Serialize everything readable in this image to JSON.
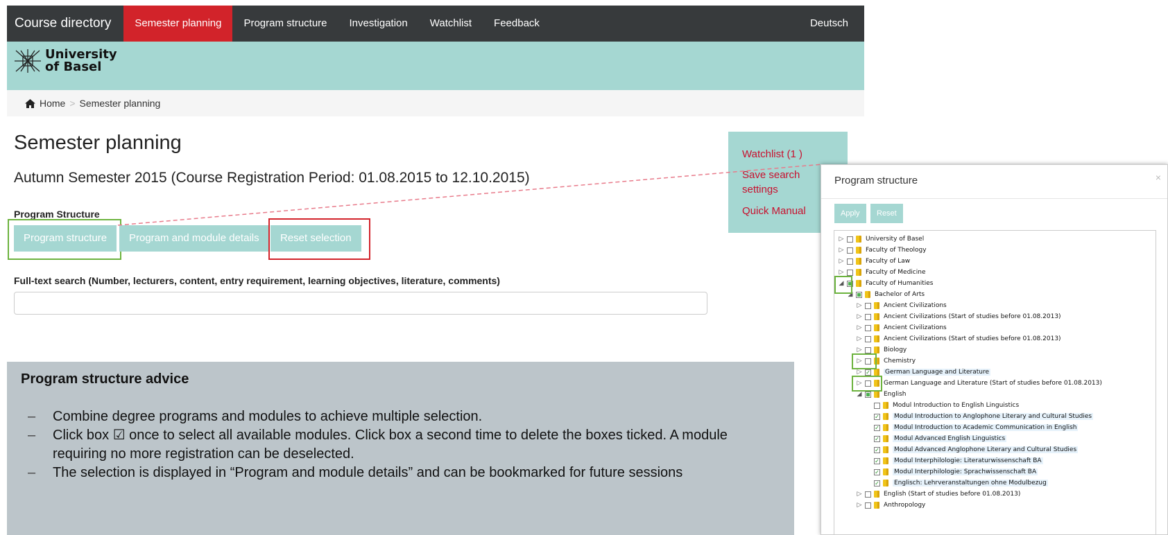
{
  "nav": {
    "brand": "Course directory",
    "items": [
      "Semester planning",
      "Program structure",
      "Investigation",
      "Watchlist",
      "Feedback"
    ],
    "active_index": 0,
    "language": "Deutsch"
  },
  "logo": {
    "line1": "University",
    "line2": "of Basel"
  },
  "breadcrumb": {
    "home": "Home",
    "current": "Semester planning"
  },
  "main": {
    "title": "Semester planning",
    "semester_info": "Autumn Semester 2015 (Course Registration Period: 01.08.2015 to 12.10.2015)",
    "program_structure_label": "Program Structure",
    "buttons": {
      "program_structure": "Program structure",
      "program_module_details": "Program and module details",
      "reset_selection": "Reset selection"
    },
    "search_label": "Full-text search (Number, lecturers, content, entry requirement, learning objectives, literature, comments)",
    "search_value": ""
  },
  "sidepanel": {
    "watchlist": "Watchlist (1 )",
    "save_search": "Save search settings",
    "quick_manual": "Quick Manual"
  },
  "advice": {
    "title": "Program structure advice",
    "items": [
      "Combine degree programs and modules to achieve multiple selection.",
      "Click box ☑ once to select all available modules. Click box a second time to delete the boxes ticked. A module requiring no more registration can be deselected.",
      "The selection is displayed in “Program and module details” and can be bookmarked for future sessions"
    ]
  },
  "dialog": {
    "title": "Program structure",
    "close": "×",
    "apply": "Apply",
    "reset": "Reset",
    "tree": [
      {
        "label": "University of Basel",
        "level": 0,
        "arrow": "closed",
        "check": "none"
      },
      {
        "label": "Faculty of Theology",
        "level": 0,
        "arrow": "closed",
        "check": "none"
      },
      {
        "label": "Faculty of Law",
        "level": 0,
        "arrow": "closed",
        "check": "none"
      },
      {
        "label": "Faculty of Medicine",
        "level": 0,
        "arrow": "closed",
        "check": "none"
      },
      {
        "label": "Faculty of Humanities",
        "level": 0,
        "arrow": "open",
        "check": "partial"
      },
      {
        "label": "Bachelor of Arts",
        "level": 1,
        "arrow": "open",
        "check": "partial"
      },
      {
        "label": "Ancient Civilizations",
        "level": 2,
        "arrow": "closed",
        "check": "none"
      },
      {
        "label": "Ancient Civilizations (Start of studies before 01.08.2013)",
        "level": 2,
        "arrow": "closed",
        "check": "none"
      },
      {
        "label": "Ancient Civilizations",
        "level": 2,
        "arrow": "closed",
        "check": "none"
      },
      {
        "label": "Ancient Civilizations (Start of studies before 01.08.2013)",
        "level": 2,
        "arrow": "closed",
        "check": "none"
      },
      {
        "label": "Biology",
        "level": 2,
        "arrow": "closed",
        "check": "none"
      },
      {
        "label": "Chemistry",
        "level": 2,
        "arrow": "closed",
        "check": "none"
      },
      {
        "label": "German Language and Literature",
        "level": 2,
        "arrow": "closed",
        "check": "checked",
        "highlight": true
      },
      {
        "label": "German Language and Literature (Start of studies before 01.08.2013)",
        "level": 2,
        "arrow": "closed",
        "check": "none"
      },
      {
        "label": "English",
        "level": 2,
        "arrow": "open",
        "check": "partial"
      },
      {
        "label": "Modul Introduction to English Linguistics",
        "level": 3,
        "arrow": "",
        "check": "none"
      },
      {
        "label": "Modul Introduction to Anglophone Literary and Cultural Studies",
        "level": 3,
        "arrow": "",
        "check": "checked",
        "highlight": true
      },
      {
        "label": "Modul Introduction to Academic Communication in English",
        "level": 3,
        "arrow": "",
        "check": "checked",
        "highlight": true
      },
      {
        "label": "Modul Advanced English Linguistics",
        "level": 3,
        "arrow": "",
        "check": "checked",
        "highlight": true
      },
      {
        "label": "Modul Advanced Anglophone Literary and Cultural Studies",
        "level": 3,
        "arrow": "",
        "check": "checked",
        "highlight": true
      },
      {
        "label": "Modul Interphilologie: Literaturwissenschaft BA",
        "level": 3,
        "arrow": "",
        "check": "checked",
        "highlight": true
      },
      {
        "label": "Modul Interphilologie: Sprachwissenschaft BA",
        "level": 3,
        "arrow": "",
        "check": "checked",
        "highlight": true
      },
      {
        "label": "Englisch: Lehrveranstaltungen ohne Modulbezug",
        "level": 3,
        "arrow": "",
        "check": "checked",
        "highlight": true
      },
      {
        "label": "English (Start of studies before 01.08.2013)",
        "level": 2,
        "arrow": "closed",
        "check": "none"
      },
      {
        "label": "Anthropology",
        "level": 2,
        "arrow": "closed",
        "check": "none"
      }
    ]
  },
  "colors": {
    "nav_bg": "#373a3c",
    "active_red": "#d2232a",
    "mint": "#a5d7d2",
    "advice_bg": "#bcc5ca",
    "link_red": "#c8102e",
    "highlight_green": "#6cb33e"
  }
}
